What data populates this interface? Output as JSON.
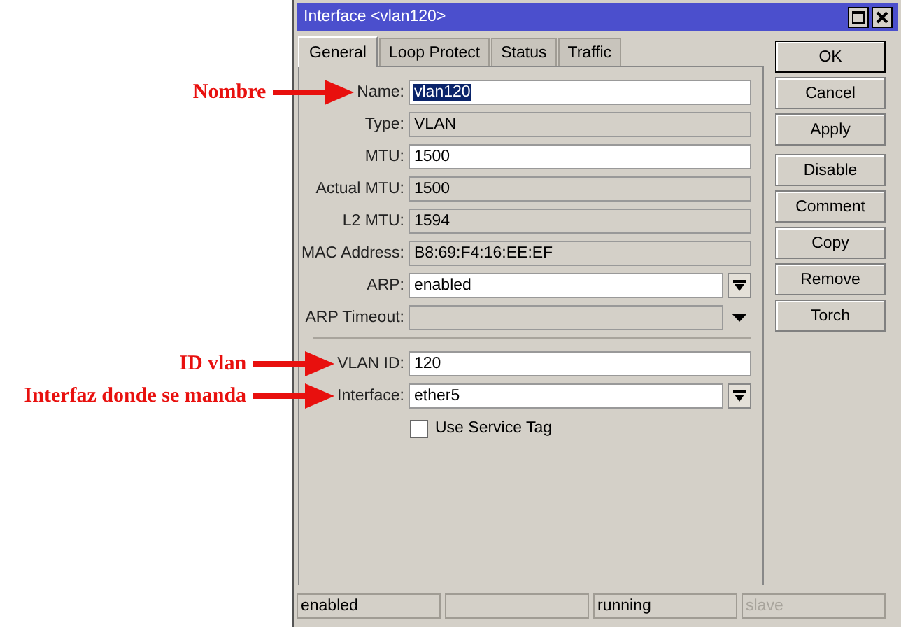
{
  "window": {
    "title": "Interface <vlan120>",
    "controls": [
      {
        "kind": "maximize"
      },
      {
        "kind": "close"
      }
    ]
  },
  "tabs": [
    {
      "label": "General",
      "selected": true
    },
    {
      "label": "Loop Protect",
      "selected": false
    },
    {
      "label": "Status",
      "selected": false
    },
    {
      "label": "Traffic",
      "selected": false
    }
  ],
  "fields": [
    {
      "kind": "input",
      "label": "Name:",
      "value": "vlan120",
      "highlighted": true,
      "annotation": "Nombre"
    },
    {
      "kind": "readonly",
      "label": "Type:",
      "value": "VLAN",
      "highlighted": false
    },
    {
      "kind": "input",
      "label": "MTU:",
      "value": "1500",
      "highlighted": false
    },
    {
      "kind": "readonly",
      "label": "Actual MTU:",
      "value": "1500",
      "highlighted": false
    },
    {
      "kind": "readonly",
      "label": "L2 MTU:",
      "value": "1594",
      "highlighted": false
    },
    {
      "kind": "readonly",
      "label": "MAC Address:",
      "value": "B8:69:F4:16:EE:EF",
      "highlighted": false
    },
    {
      "kind": "select",
      "label": "ARP:",
      "value": "enabled",
      "highlighted": false
    },
    {
      "kind": "readonly-select",
      "label": "ARP Timeout:"
    },
    {
      "kind": "separator"
    },
    {
      "kind": "input",
      "label": "VLAN ID:",
      "value": "120",
      "highlighted": false,
      "annotation": "ID vlan"
    },
    {
      "kind": "select",
      "label": "Interface:",
      "value": "ether5",
      "highlighted": false,
      "annotation": "Interfaz donde se manda"
    },
    {
      "kind": "checkbox",
      "label": "Use Service Tag",
      "checked": false
    }
  ],
  "buttons": [
    [
      {
        "label": "OK",
        "default": true
      },
      {
        "label": "Cancel",
        "default": false
      },
      {
        "label": "Apply",
        "default": false
      }
    ],
    [
      {
        "label": "Disable",
        "default": false
      },
      {
        "label": "Comment",
        "default": false
      },
      {
        "label": "Copy",
        "default": false
      },
      {
        "label": "Remove",
        "default": false
      },
      {
        "label": "Torch",
        "default": false
      }
    ]
  ],
  "status_bar": [
    {
      "kind": "text",
      "text": "enabled",
      "disabled": false
    },
    {
      "kind": "blank"
    },
    {
      "kind": "text",
      "text": "running",
      "disabled": false
    },
    {
      "kind": "text",
      "text": "slave",
      "disabled": true
    }
  ]
}
